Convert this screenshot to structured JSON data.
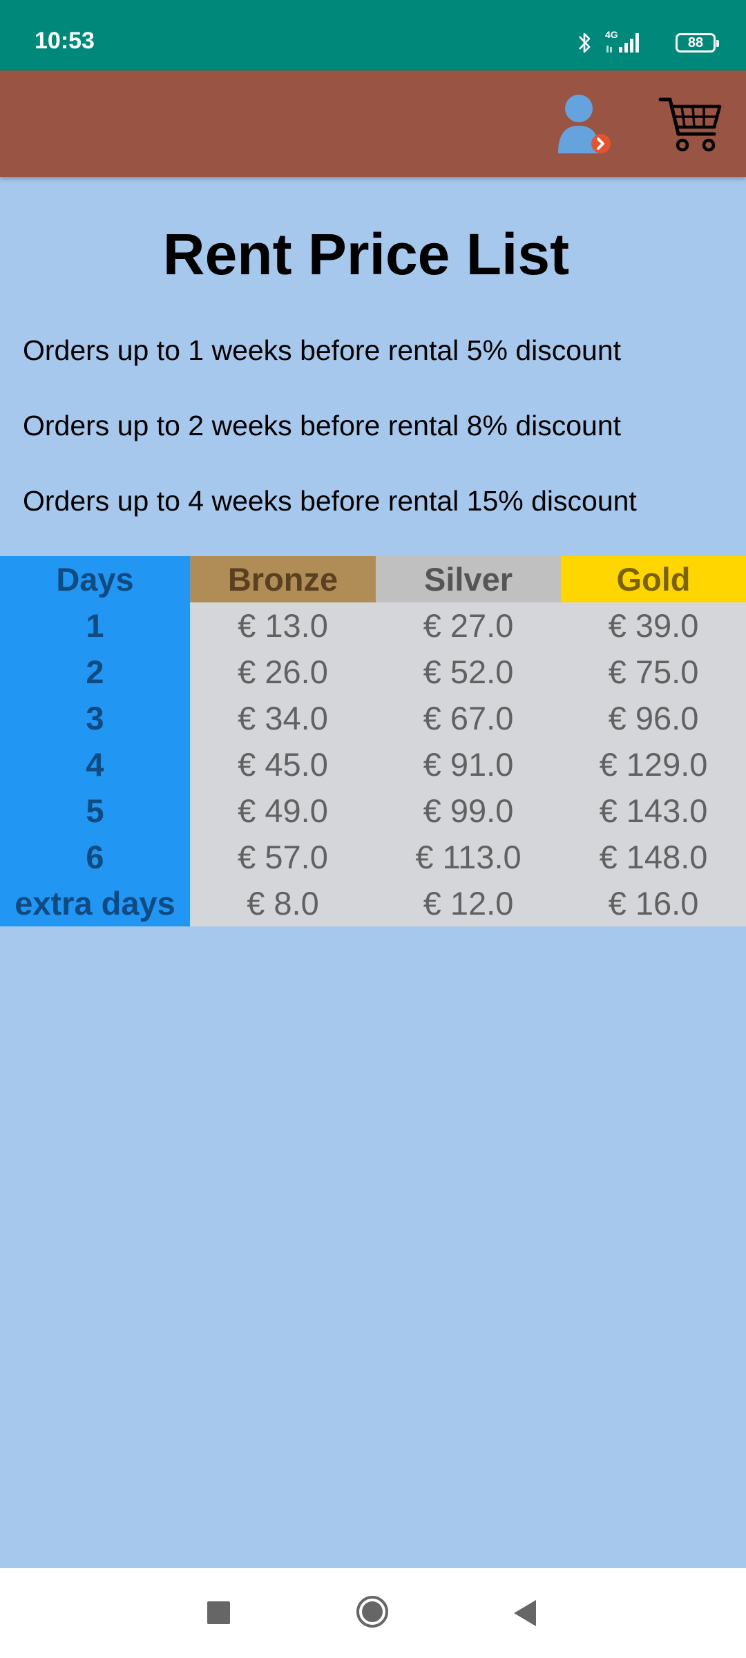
{
  "status_bar": {
    "time": "10:53",
    "network": "4G",
    "battery": "88",
    "icons": [
      "bluetooth-icon",
      "signal-icon",
      "battery-icon"
    ]
  },
  "app_bar": {
    "icons": [
      "profile-icon",
      "cart-icon"
    ],
    "colors": {
      "background": "#9a5443"
    }
  },
  "page": {
    "title": "Rent Price List",
    "discounts": [
      "Orders up to 1 weeks before rental 5% discount",
      "Orders up to 2 weeks before rental 8% discount",
      "Orders up to 4 weeks before rental 15% discount"
    ]
  },
  "price_table": {
    "headers": [
      "Days",
      "Bronze",
      "Silver",
      "Gold"
    ],
    "rows": [
      [
        "1",
        "€ 13.0",
        "€ 27.0",
        "€ 39.0"
      ],
      [
        "2",
        "€ 26.0",
        "€ 52.0",
        "€ 75.0"
      ],
      [
        "3",
        "€ 34.0",
        "€ 67.0",
        "€ 96.0"
      ],
      [
        "4",
        "€ 45.0",
        "€ 91.0",
        "€ 129.0"
      ],
      [
        "5",
        "€ 49.0",
        "€ 99.0",
        "€ 143.0"
      ],
      [
        "6",
        "€ 57.0",
        "€ 113.0",
        "€ 148.0"
      ],
      [
        "extra days",
        "€ 8.0",
        "€ 12.0",
        "€ 16.0"
      ]
    ],
    "colors": {
      "days": "#2196f3",
      "bronze": "#b08d57",
      "silver": "#c0c0c0",
      "gold": "#ffd600",
      "cells": "#d4d6da"
    }
  },
  "nav_bar": {
    "icons": [
      "recent-apps-icon",
      "home-icon",
      "back-icon"
    ]
  }
}
